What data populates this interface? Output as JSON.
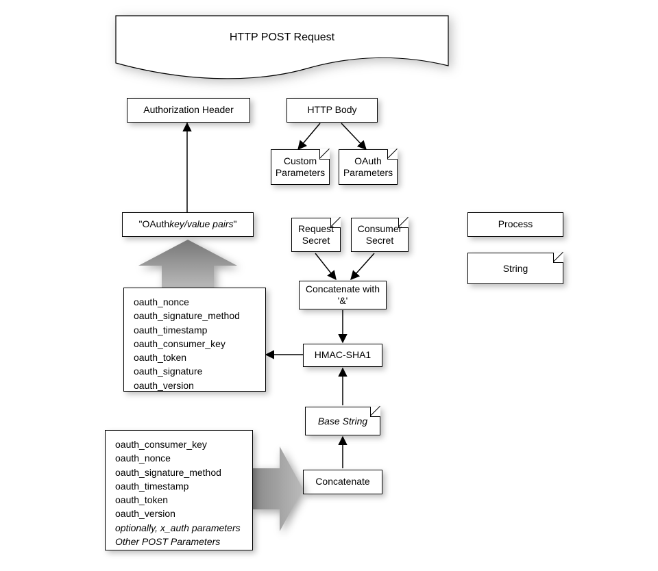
{
  "banner": {
    "title": "HTTP POST Request"
  },
  "auth_header": {
    "label": "Authorization Header"
  },
  "http_body": {
    "label": "HTTP Body"
  },
  "custom_params": {
    "label": "Custom\nParameters"
  },
  "oauth_params": {
    "label": "OAuth\nParameters"
  },
  "legend": {
    "process": "Process",
    "string": "String"
  },
  "key_value_box": {
    "prefix": "\"OAuth ",
    "italic": "key/value pairs",
    "suffix": "\""
  },
  "request_secret": {
    "label": "Request\nSecret"
  },
  "consumer_secret": {
    "label": "Consumer\nSecret"
  },
  "concat_amp": {
    "label": "Concatenate with\n'&'"
  },
  "hmac": {
    "label": "HMAC-SHA1"
  },
  "base_string": {
    "label": "Base String"
  },
  "concatenate": {
    "label": "Concatenate"
  },
  "list_top": {
    "items": [
      "oauth_nonce",
      "oauth_signature_method",
      "oauth_timestamp",
      "oauth_consumer_key",
      "oauth_token",
      "oauth_signature",
      "oauth_version"
    ]
  },
  "list_bottom": {
    "items_plain": [
      "oauth_consumer_key",
      "oauth_nonce",
      "oauth_signature_method",
      "oauth_timestamp",
      "oauth_token",
      "oauth_version"
    ],
    "items_italic": [
      "optionally, x_auth parameters",
      "Other POST Parameters"
    ]
  }
}
